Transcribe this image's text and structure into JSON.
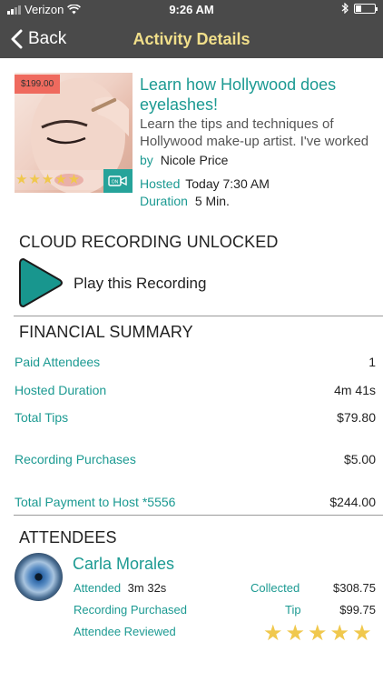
{
  "status_bar": {
    "carrier": "Verizon",
    "time": "9:26 AM"
  },
  "nav": {
    "back_label": "Back",
    "title": "Activity Details"
  },
  "activity": {
    "price_badge": "$199.00",
    "title": "Learn how Hollywood does eyelashes!",
    "description": "Learn the tips and techniques of Hollywood make-up artist. I've worked",
    "by_label": "by",
    "host_name": "Nicole Price",
    "hosted_label": "Hosted",
    "hosted_value": "Today 7:30 AM",
    "duration_label": "Duration",
    "duration_value": "5 Min.",
    "rating_stars": "★★★★★"
  },
  "recording": {
    "heading": "CLOUD RECORDING UNLOCKED",
    "play_label": "Play this Recording"
  },
  "financial": {
    "heading": "FINANCIAL SUMMARY",
    "rows": [
      {
        "label": "Paid Attendees",
        "value": "1"
      },
      {
        "label": "Hosted Duration",
        "value": "4m 41s"
      },
      {
        "label": "Total Tips",
        "value": "$79.80"
      },
      {
        "label": "Recording Purchases",
        "value": "$5.00"
      },
      {
        "label": "Total Payment to Host *5556",
        "value": "$244.00"
      }
    ]
  },
  "attendees": {
    "heading": "ATTENDEES",
    "items": [
      {
        "name": "Carla Morales",
        "attended_label": "Attended",
        "attended_value": "3m 32s",
        "collected_label": "Collected",
        "collected_value": "$308.75",
        "recording_label": "Recording Purchased",
        "tip_label": "Tip",
        "tip_value": "$99.75",
        "reviewed_label": "Attendee Reviewed",
        "review_stars": "★★★★★"
      }
    ]
  },
  "colors": {
    "accent": "#1c9a92",
    "nav_bg": "#4a4a4a",
    "nav_title": "#f1df8a",
    "star": "#f0c84d",
    "badge": "#ef6a5e"
  }
}
